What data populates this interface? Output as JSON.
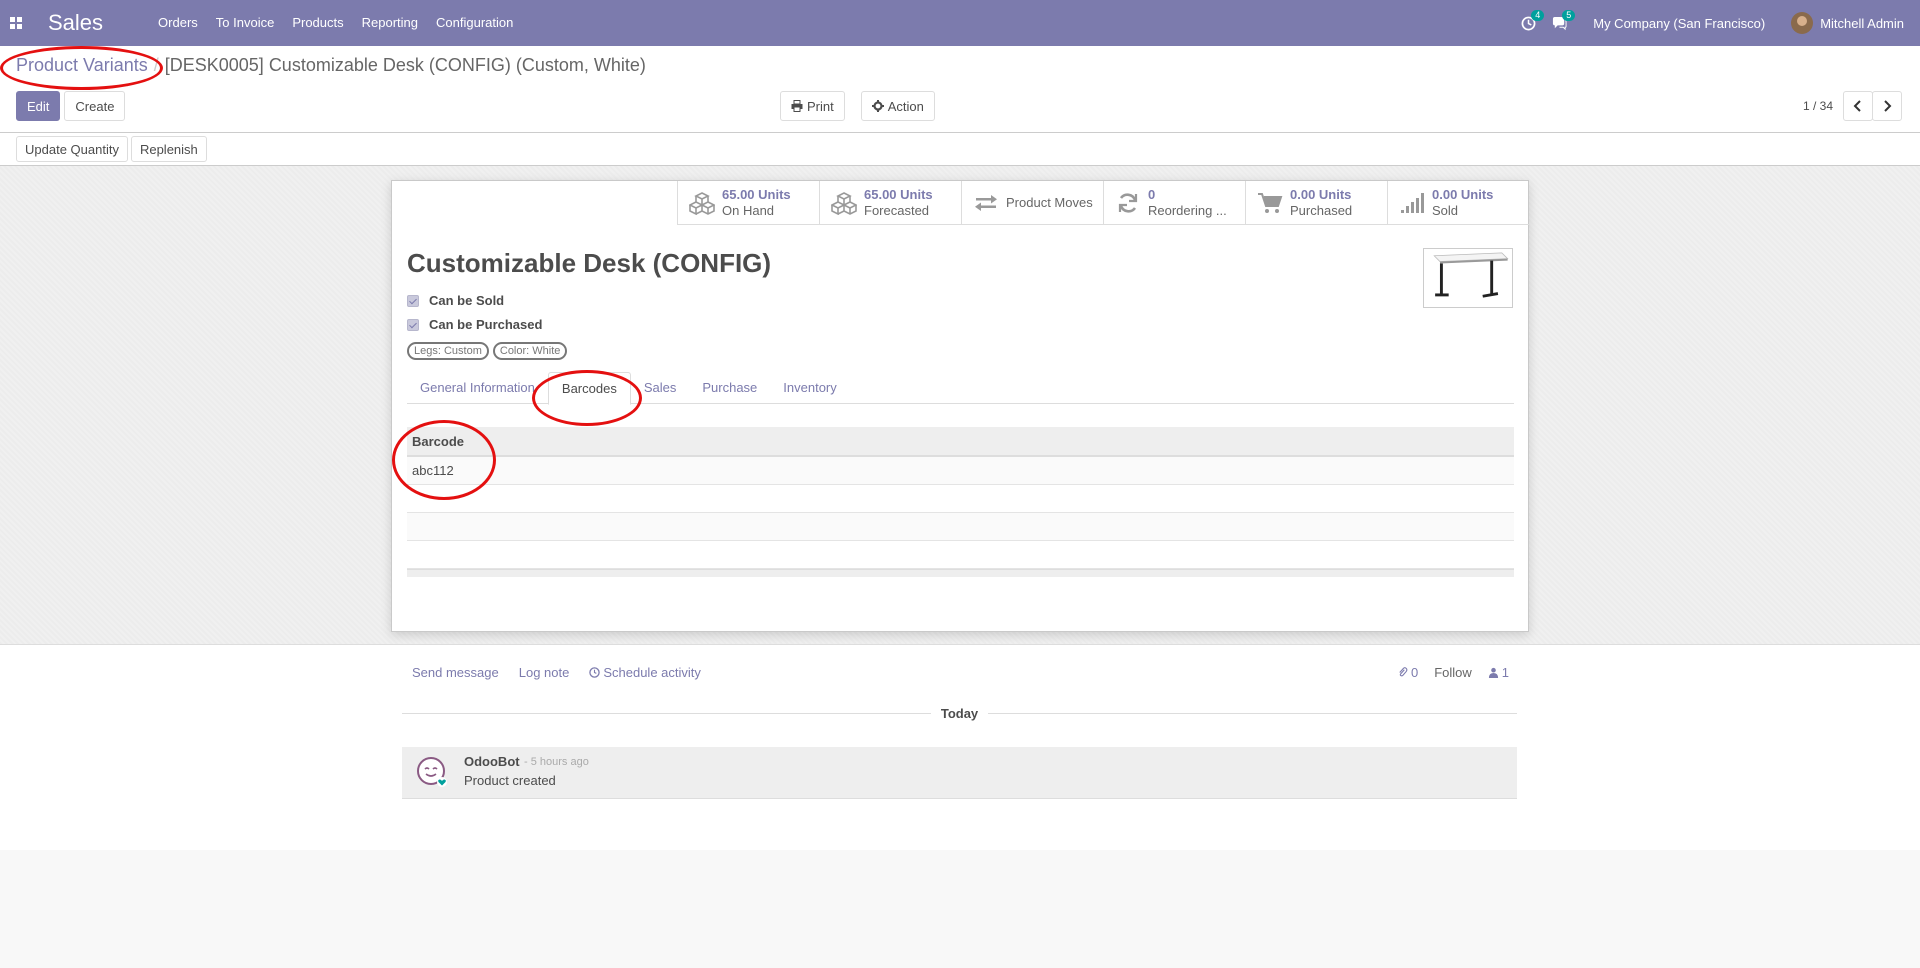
{
  "navbar": {
    "app_name": "Sales",
    "menu": [
      "Orders",
      "To Invoice",
      "Products",
      "Reporting",
      "Configuration"
    ],
    "activity_badge": "4",
    "messages_badge": "5",
    "company": "My Company (San Francisco)",
    "user": "Mitchell Admin",
    "color": "#7c7bad"
  },
  "breadcrumb": {
    "parent": "Product Variants",
    "current": "[DESK0005] Customizable Desk (CONFIG) (Custom, White)"
  },
  "control_panel": {
    "edit_label": "Edit",
    "create_label": "Create",
    "print_label": "Print",
    "action_label": "Action",
    "pager": "1 / 34"
  },
  "statusbar": {
    "update_quantity_label": "Update Quantity",
    "replenish_label": "Replenish"
  },
  "stat_buttons": {
    "on_hand": {
      "value": "65.00 Units",
      "label": "On Hand",
      "icon": "cubes-icon"
    },
    "forecasted": {
      "value": "65.00 Units",
      "label": "Forecasted",
      "icon": "cubes-icon"
    },
    "moves": {
      "label": "Product Moves",
      "icon": "exchange-arrows-icon"
    },
    "reordering": {
      "value": "0",
      "label": "Reordering ...",
      "icon": "refresh-icon"
    },
    "purchased": {
      "value": "0.00 Units",
      "label": "Purchased",
      "icon": "cart-icon"
    },
    "sold": {
      "value": "0.00 Units",
      "label": "Sold",
      "icon": "signal-icon"
    }
  },
  "product": {
    "name": "Customizable Desk (CONFIG)",
    "can_be_sold_label": "Can be Sold",
    "can_be_purchased_label": "Can be Purchased",
    "tags": [
      "Legs: Custom",
      "Color: White"
    ]
  },
  "tabs": {
    "items": [
      "General Information",
      "Barcodes",
      "Sales",
      "Purchase",
      "Inventory"
    ],
    "active": "Barcodes"
  },
  "barcodes": {
    "header": "Barcode",
    "rows": [
      "abc112"
    ]
  },
  "chatter": {
    "send_message": "Send message",
    "log_note": "Log note",
    "schedule_activity": "Schedule activity",
    "attachments_count": "0",
    "follow_label": "Follow",
    "followers_count": "1",
    "date_separator": "Today",
    "message": {
      "author": "OdooBot",
      "time": "- 5 hours ago",
      "body": "Product created"
    }
  },
  "annotation_color": "#e41010"
}
